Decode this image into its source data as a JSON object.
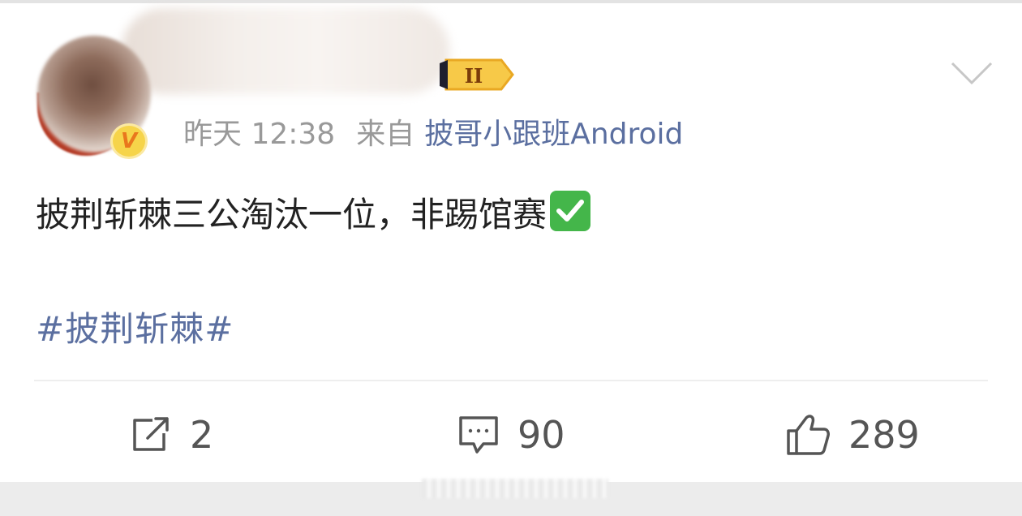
{
  "post": {
    "time": "昨天 12:38",
    "source_prefix": "来自",
    "source_app": "披哥小跟班Android",
    "content": "披荆斩棘三公淘汰一位，非踢馆赛",
    "hashtag": "#披荆斩棘#",
    "badges": {
      "verified": "V",
      "level": "II"
    }
  },
  "actions": {
    "repost_count": "2",
    "comment_count": "90",
    "like_count": "289"
  },
  "icons": {
    "verified": "verified-v-icon",
    "level": "level-badge-icon",
    "more": "chevron-down-icon",
    "repost": "repost-icon",
    "comment": "comment-icon",
    "like": "thumbs-up-icon",
    "check": "check-mark-emoji"
  },
  "colors": {
    "link": "#5b6fa0",
    "meta": "#999999",
    "text": "#222222",
    "check": "#44b64a",
    "badge_gold": "#f6d44a"
  }
}
